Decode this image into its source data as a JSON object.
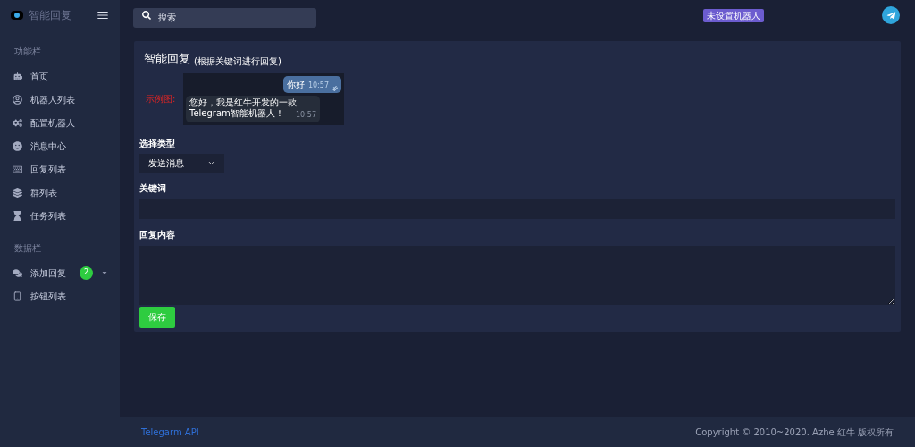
{
  "brand": {
    "name": "智能回复"
  },
  "search": {
    "placeholder": "搜索"
  },
  "header": {
    "bot_status": "未设置机器人"
  },
  "sidebar": {
    "sections": [
      {
        "title": "功能栏",
        "items": [
          {
            "label": "首页"
          },
          {
            "label": "机器人列表"
          },
          {
            "label": "配置机器人"
          },
          {
            "label": "消息中心"
          },
          {
            "label": "回复列表"
          },
          {
            "label": "群列表"
          },
          {
            "label": "任务列表"
          }
        ]
      },
      {
        "title": "数据栏",
        "items": [
          {
            "label": "添加回复",
            "badge": "2",
            "expandable": true
          },
          {
            "label": "按钮列表"
          }
        ]
      }
    ]
  },
  "page": {
    "title": "智能回复",
    "subtitle": "(根据关键词进行回复)",
    "example": {
      "label": "示例图:",
      "messages": [
        {
          "kind": "outgoing",
          "text": "你好",
          "time": "10:57"
        },
        {
          "kind": "incoming",
          "text": "您好，我是红牛开发的一款Telegram智能机器人！",
          "time": "10:57"
        }
      ]
    },
    "form": {
      "type_label": "选择类型",
      "type_value": "发送消息",
      "keyword_label": "关键词",
      "content_label": "回复内容",
      "save": "保存"
    }
  },
  "footer": {
    "link": "Telegarm API",
    "copyright": "Copyright © 2010~2020. Azhe 红牛 版权所有"
  }
}
